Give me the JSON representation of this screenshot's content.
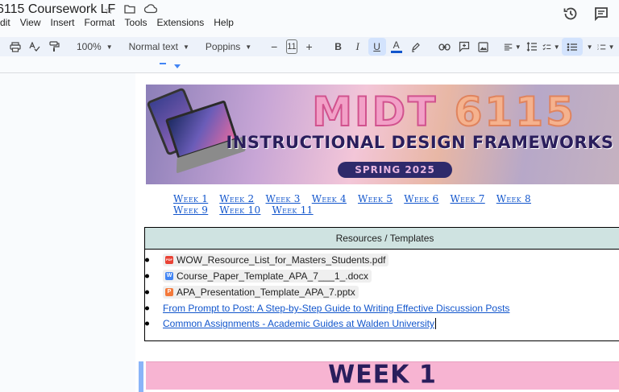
{
  "document": {
    "title": "6115 Coursework LF"
  },
  "menu": {
    "items": [
      "dit",
      "View",
      "Insert",
      "Format",
      "Tools",
      "Extensions",
      "Help"
    ]
  },
  "toolbar": {
    "zoom": "100%",
    "style": "Normal text",
    "font": "Poppins",
    "font_size": "11",
    "minus": "−",
    "plus": "+",
    "bold": "B",
    "italic": "I",
    "underline": "U",
    "text_color": "A"
  },
  "banner": {
    "title_left": "MIDT",
    "title_right": "6115",
    "subtitle": "INSTRUCTIONAL DESIGN FRAMEWORKS",
    "term": "SPRING 2025"
  },
  "weeks": [
    "Week 1",
    "Week 2",
    "Week 3",
    "Week 4",
    "Week 5",
    "Week 6",
    "Week 7",
    "Week 8",
    "Week 9",
    "Week 10",
    "Week 11"
  ],
  "resources": {
    "header": "Resources / Templates",
    "files": [
      {
        "name": "WOW_Resource_List_for_Masters_Students.pdf",
        "type": "pdf",
        "icon": "PDF"
      },
      {
        "name": "Course_Paper_Template_APA_7___1_.docx",
        "type": "doc",
        "icon": "W"
      },
      {
        "name": "APA_Presentation_Template_APA_7.pptx",
        "type": "ppt",
        "icon": "P"
      }
    ],
    "links": [
      "From Prompt to Post: A Step-by-Step Guide to Writing Effective Discussion Posts",
      "Common Assignments - Academic Guides at Walden University"
    ]
  },
  "section": {
    "heading": "WEEK 1"
  },
  "colors": {
    "toolbar_bg": "#edf2fa",
    "link": "#1155cc",
    "table_header": "#cfe3e1",
    "week_banner": "#f7b4d2"
  }
}
